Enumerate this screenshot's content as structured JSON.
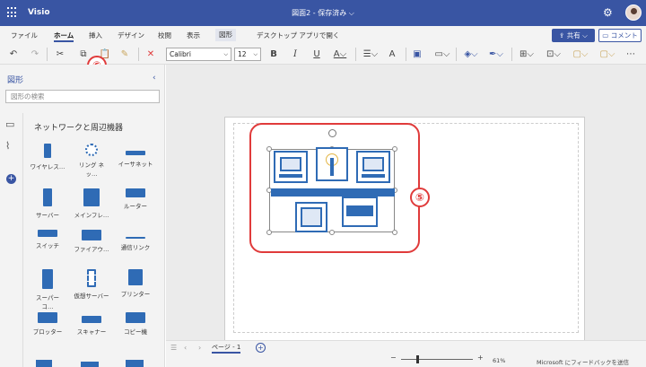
{
  "titlebar": {
    "app": "Visio",
    "document": "図面2 - 保存済み ⌵"
  },
  "menu": {
    "tabs": [
      "ファイル",
      "ホーム",
      "挿入",
      "デザイン",
      "校閲",
      "表示",
      "図形",
      "デスクトップ アプリで開く"
    ],
    "active": "ホーム",
    "share": "共有",
    "comment": "コメント"
  },
  "ribbon": {
    "font": "Calibri",
    "size": "12"
  },
  "callouts": {
    "copy": "⑥",
    "selection": "⑤"
  },
  "panel": {
    "title": "図形",
    "search_placeholder": "図形の検索",
    "stencil": "ネットワークと周辺機器",
    "shapes": [
      "ワイヤレス…",
      "リング ネッ…",
      "イーサネット",
      "サーバー",
      "メインフレ…",
      "ルーター",
      "スイッチ",
      "ファイアウ…",
      "通信リンク",
      "スーパー コ…",
      "仮想サーバー",
      "プリンター",
      "プロッター",
      "スキャナー",
      "コピー機"
    ]
  },
  "statusbar": {
    "page": "ページ - 1",
    "zoom": "61%",
    "feedback": "Microsoft にフィードバックを送信"
  },
  "colors": {
    "brand": "#3955a3",
    "callout": "#e03b3b",
    "shape": "#2f6bb5"
  }
}
